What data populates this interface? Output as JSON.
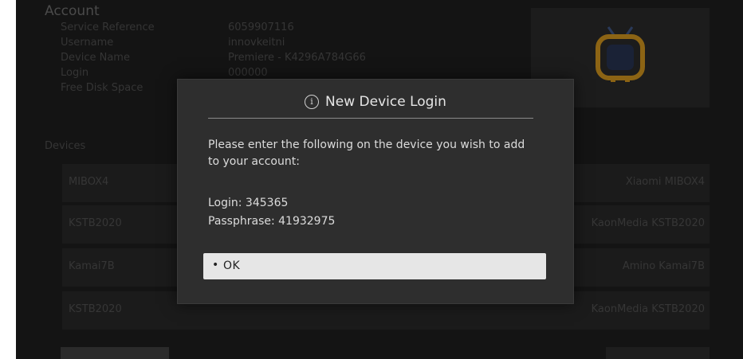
{
  "account": {
    "title": "Account",
    "rows": [
      {
        "label": "Service Reference",
        "value": "6059907116"
      },
      {
        "label": "Username",
        "value": "innovkeitni"
      },
      {
        "label": "Device Name",
        "value": "Premiere - K4296A784G66"
      },
      {
        "label": "Login",
        "value": "000000"
      },
      {
        "label": "Free Disk Space",
        "value": ""
      }
    ]
  },
  "devices": {
    "label": "Devices",
    "items": [
      {
        "name": "MIBOX4",
        "model": "Xiaomi MIBOX4"
      },
      {
        "name": "KSTB2020",
        "model": "KaonMedia KSTB2020"
      },
      {
        "name": "Kamai7B",
        "model": "Amino Kamai7B"
      },
      {
        "name": "KSTB2020",
        "model": "KaonMedia KSTB2020"
      }
    ]
  },
  "dialog": {
    "icon": "info-icon",
    "icon_glyph": "i",
    "title": "New Device Login",
    "message": "Please enter the following on the device you wish to add to your account:",
    "login_line": "Login: 345365",
    "passphrase_line": "Passphrase: 41932975",
    "ok_bullet": "•",
    "ok_label": "OK"
  },
  "colors": {
    "dialog_bg": "#2e2e2e",
    "button_bg": "#e6e6e6",
    "tv_icon": "#c8901a"
  }
}
